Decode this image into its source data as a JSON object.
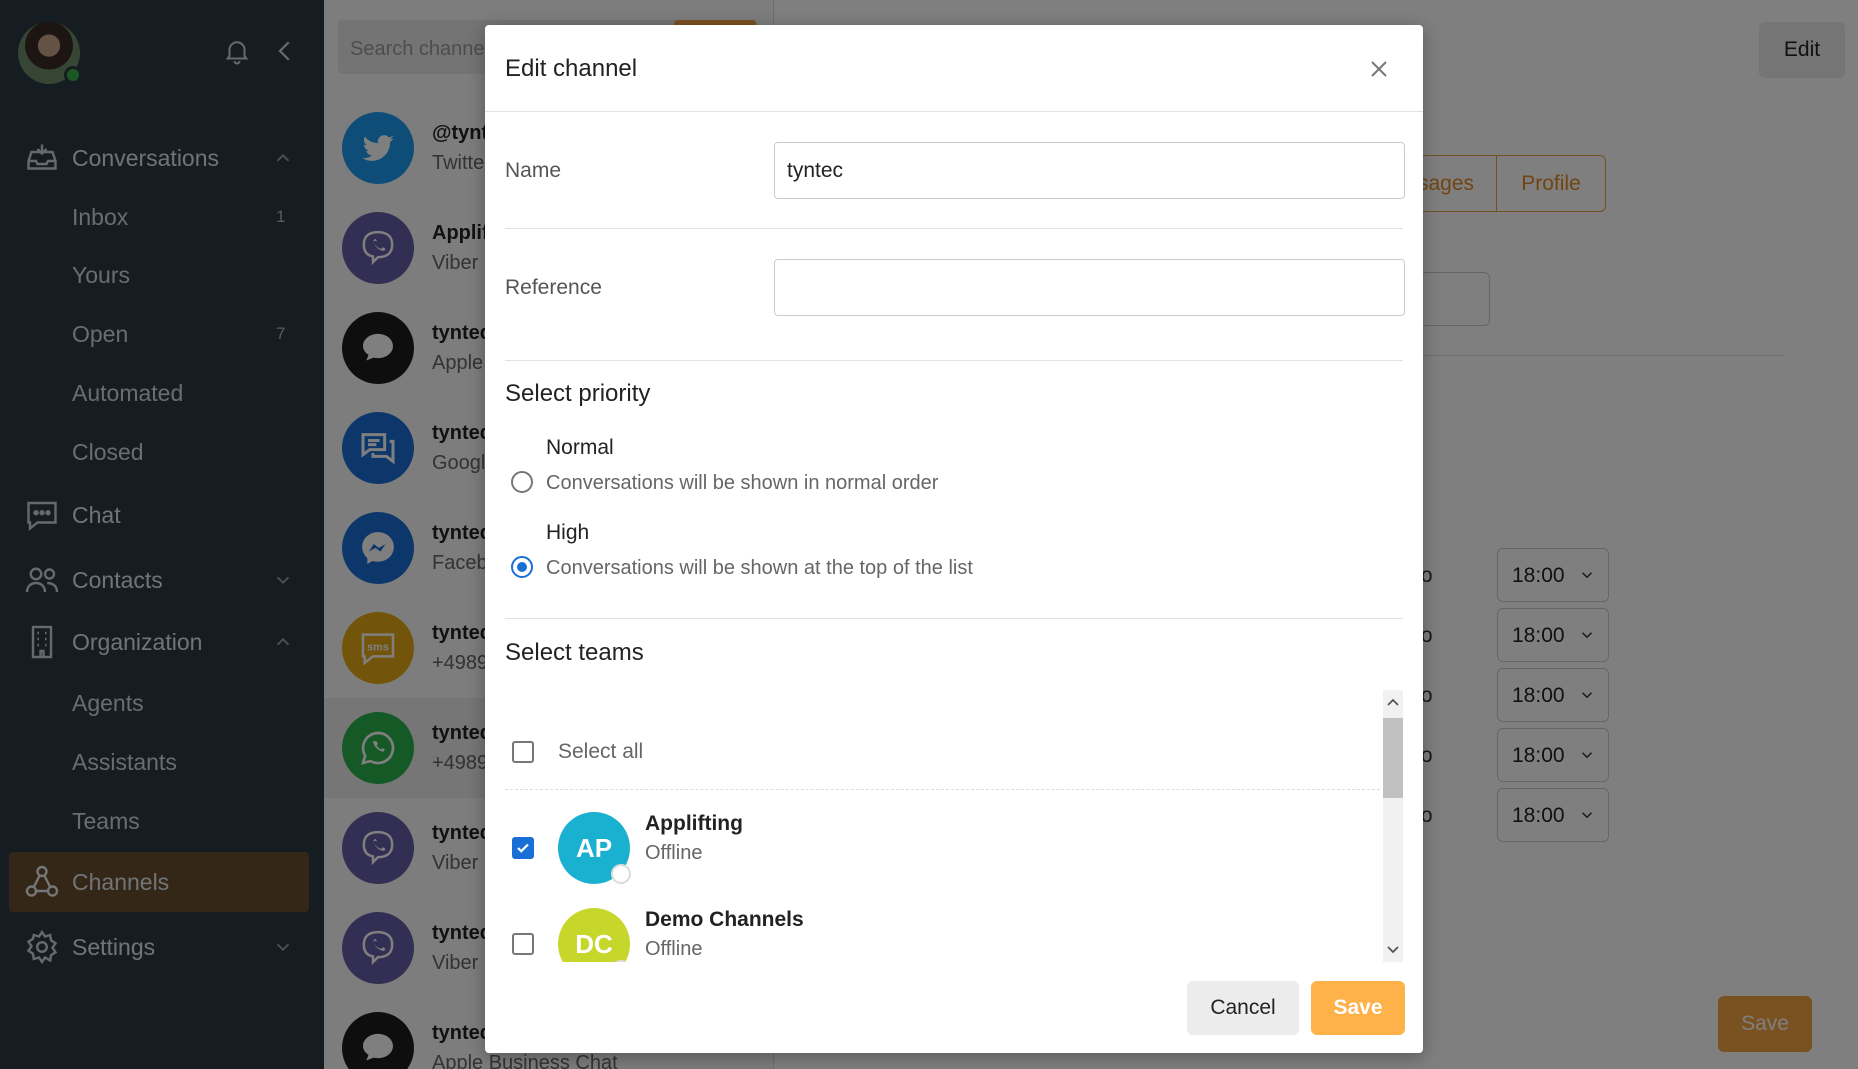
{
  "colors": {
    "sidebar_bg": "#2d3a45",
    "active_nav": "#6b4e2f",
    "accent": "#f4a340",
    "primary_blue": "#1a6fd6"
  },
  "sidebar": {
    "items": {
      "conversations": {
        "label": "Conversations",
        "icon": "inbox-tray-icon",
        "expanded": true
      },
      "inbox": {
        "label": "Inbox",
        "count": "1"
      },
      "yours": {
        "label": "Yours"
      },
      "open": {
        "label": "Open",
        "count": "7"
      },
      "automated": {
        "label": "Automated"
      },
      "closed": {
        "label": "Closed"
      },
      "chat": {
        "label": "Chat",
        "icon": "chat-bubble-icon"
      },
      "contacts": {
        "label": "Contacts",
        "icon": "people-icon"
      },
      "organization": {
        "label": "Organization",
        "icon": "building-icon",
        "expanded": true
      },
      "agents": {
        "label": "Agents"
      },
      "assistants": {
        "label": "Assistants"
      },
      "teams": {
        "label": "Teams"
      },
      "channels": {
        "label": "Channels",
        "icon": "channels-icon",
        "active": true
      },
      "settings": {
        "label": "Settings",
        "icon": "gear-icon"
      }
    }
  },
  "channel_list": {
    "search_placeholder": "Search channe",
    "rows": [
      {
        "title": "@tynt",
        "sub": "Twitte",
        "icon": "twitter-icon",
        "color": "#1d9bf0"
      },
      {
        "title": "Applif",
        "sub": "Viber",
        "icon": "viber-icon",
        "color": "#665ca7"
      },
      {
        "title": "tynted",
        "sub": "Apple",
        "icon": "message-icon",
        "color": "#1c1c1c"
      },
      {
        "title": "tynted",
        "sub": "Googl",
        "icon": "google-chat-icon",
        "color": "#1a6fd6"
      },
      {
        "title": "tynted",
        "sub": "Faceb",
        "icon": "messenger-icon",
        "color": "#1a6fd6"
      },
      {
        "title": "tynted",
        "sub": "+4989",
        "icon": "sms-icon",
        "color": "#e6a817"
      },
      {
        "title": "tynted",
        "sub": "+4989",
        "icon": "whatsapp-icon",
        "color": "#2ab24e"
      },
      {
        "title": "tynted",
        "sub": "Viber",
        "icon": "viber-icon",
        "color": "#665ca7"
      },
      {
        "title": "tynted",
        "sub": "Viber",
        "icon": "viber-icon",
        "color": "#665ca7"
      },
      {
        "title": "tynted",
        "sub": "Apple Business Chat",
        "icon": "message-icon",
        "color": "#1c1c1c"
      }
    ]
  },
  "detail": {
    "edit_label": "Edit",
    "tab_messages": "sages",
    "tab_profile": "Profile",
    "times": [
      {
        "to": "to",
        "value": "18:00"
      },
      {
        "to": "to",
        "value": "18:00"
      },
      {
        "to": "to",
        "value": "18:00"
      },
      {
        "to": "to",
        "value": "18:00"
      },
      {
        "to": "to",
        "value": "18:00"
      }
    ],
    "save_label": "Save"
  },
  "modal": {
    "title": "Edit channel",
    "name_label": "Name",
    "name_value": "tyntec",
    "reference_label": "Reference",
    "reference_value": "",
    "priority_title": "Select priority",
    "priority": {
      "normal_title": "Normal",
      "normal_desc": "Conversations will be shown in normal order",
      "high_title": "High",
      "high_desc": "Conversations will be shown at the top of the list",
      "selected": "high"
    },
    "teams_title": "Select teams",
    "select_all_label": "Select all",
    "teams": [
      {
        "initials": "AP",
        "name": "Applifting",
        "status": "Offline",
        "checked": true,
        "color": "#1ab0cf"
      },
      {
        "initials": "DC",
        "name": "Demo Channels",
        "status": "Offline",
        "checked": false,
        "color": "#c7d62a"
      }
    ],
    "cancel_label": "Cancel",
    "save_label": "Save"
  }
}
